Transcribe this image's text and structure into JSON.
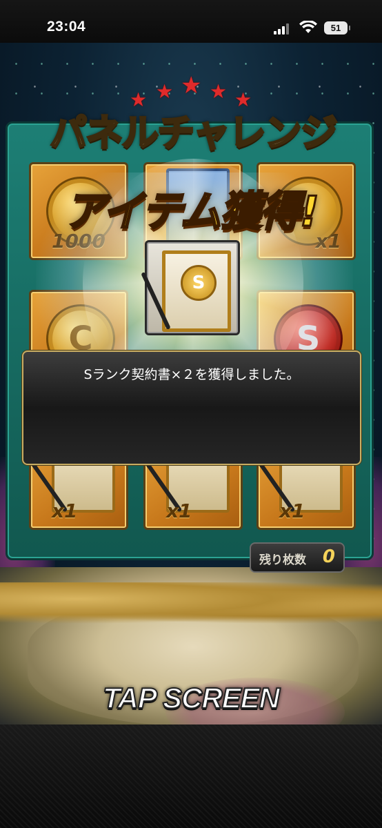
{
  "status_bar": {
    "time": "23:04",
    "battery": "51"
  },
  "game": {
    "board_title": "パネルチャレンジ",
    "get_title": "アイテム獲得!",
    "panels": [
      {
        "symbol": "",
        "count": "1000"
      },
      {
        "symbol": "",
        "count": ""
      },
      {
        "symbol": "",
        "count": "x1"
      },
      {
        "symbol": "C",
        "count": ""
      },
      {
        "symbol": "",
        "count": ""
      },
      {
        "symbol": "S",
        "count": ""
      },
      {
        "symbol": "",
        "count": "x1"
      },
      {
        "symbol": "",
        "count": "x1"
      },
      {
        "symbol": "",
        "count": "x1"
      }
    ],
    "item_seal": "S",
    "message": "Sランク契約書×２を獲得しました。",
    "remaining_label": "残り枚数",
    "remaining_value": "0",
    "tap_prompt": "TAP SCREEN"
  },
  "colors": {
    "board": "#1d7f75",
    "panel": "#e7a33a",
    "title_gold": "#ffd630",
    "message_border": "#c8ad63"
  }
}
